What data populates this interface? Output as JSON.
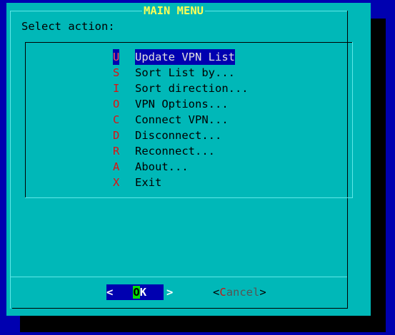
{
  "dialog": {
    "title": "MAIN MENU",
    "prompt": "Select action:",
    "items": [
      {
        "key": "U",
        "label": "Update VPN List",
        "selected": true
      },
      {
        "key": "S",
        "label": "Sort List by..."
      },
      {
        "key": "I",
        "label": "Sort direction..."
      },
      {
        "key": "O",
        "label": "VPN Options..."
      },
      {
        "key": "C",
        "label": "Connect VPN..."
      },
      {
        "key": "D",
        "label": "Disconnect..."
      },
      {
        "key": "R",
        "label": "Reconnect..."
      },
      {
        "key": "A",
        "label": "About..."
      },
      {
        "key": "X",
        "label": "Exit"
      }
    ],
    "buttons": {
      "ok": {
        "left": "<",
        "hotkey": "O",
        "rest": "K",
        "right": ">"
      },
      "cancel": {
        "left": "<",
        "hotkey": "C",
        "rest": "ancel",
        "right": ">"
      }
    }
  },
  "colors": {
    "background": "#0000b0",
    "dialog": "#00b8b8",
    "title": "#ffff55",
    "hotkey": "#e01010",
    "selection": "#0000b0"
  }
}
